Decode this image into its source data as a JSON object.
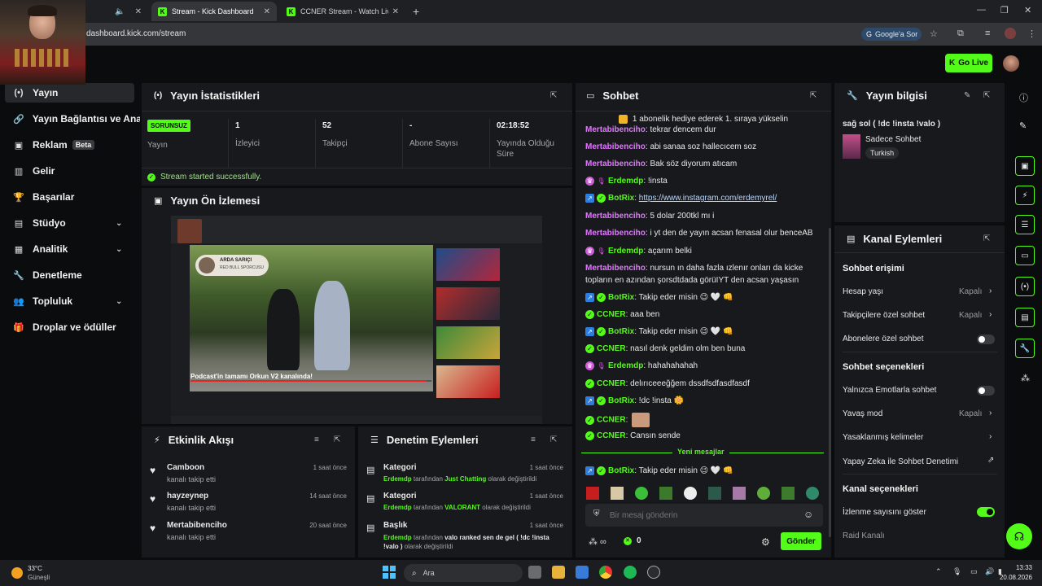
{
  "browser": {
    "tabs": [
      {
        "label": "Stream - Kick Dashboard"
      },
      {
        "label": "CCNER Stream - Watch Live on"
      }
    ],
    "url": "dashboard.kick.com/stream",
    "google_btn": "Google'a Sor"
  },
  "header": {
    "go_live": "Go Live"
  },
  "sidebar": {
    "items": [
      {
        "label": "Yayın"
      },
      {
        "label": "Yayın Bağlantısı ve Anahtar"
      },
      {
        "label": "Reklam",
        "badge": "Beta"
      },
      {
        "label": "Gelir"
      },
      {
        "label": "Başarılar"
      },
      {
        "label": "Stüdyo"
      },
      {
        "label": "Analitik"
      },
      {
        "label": "Denetleme"
      },
      {
        "label": "Topluluk"
      },
      {
        "label": "Droplar ve ödüller"
      }
    ]
  },
  "stats": {
    "title": "Yayın İstatistikleri",
    "status_badge": "SORUNSUZ",
    "status_label": "Yayın",
    "viewers": {
      "value": "1",
      "label": "İzleyici"
    },
    "followers": {
      "value": "52",
      "label": "Takipçi"
    },
    "subs": {
      "value": "-",
      "label": "Abone Sayısı"
    },
    "uptime": {
      "value": "02:18:52",
      "label": "Yayında Olduğu Süre"
    },
    "success_msg": "Stream started successfully."
  },
  "preview": {
    "title": "Yayın Ön İzlemesi",
    "caption": "Podcast'in tamamı Orkun V2 kanalında!",
    "overlay_name": "ARDA SARIÇI",
    "overlay_sub": "RED BULL SPORCUSU"
  },
  "activity": {
    "title": "Etkinlik Akışı",
    "items": [
      {
        "user": "Camboon",
        "action": "kanalı takip etti",
        "time": "1 saat önce"
      },
      {
        "user": "hayzeynep",
        "action": "kanalı takip etti",
        "time": "14 saat önce"
      },
      {
        "user": "Mertabibenciho",
        "action": "kanalı takip etti",
        "time": "20 saat önce"
      }
    ]
  },
  "moderation": {
    "title": "Denetim Eylemleri",
    "items": [
      {
        "type": "Kategori",
        "actor": "Erdemdp",
        "mid": "tarafından",
        "value": "Just Chatting",
        "tail": "olarak değiştirildi",
        "time": "1 saat önce"
      },
      {
        "type": "Kategori",
        "actor": "Erdemdp",
        "mid": "tarafından",
        "value": "VALORANT",
        "tail": "olarak değiştirildi",
        "time": "1 saat önce"
      },
      {
        "type": "Başlık",
        "actor": "Erdemdp",
        "mid": "tarafından",
        "value": "valo ranked sen de gel ( !dc !insta !valo )",
        "tail": "olarak değiştirildi",
        "time": "1 saat önce"
      }
    ]
  },
  "chat": {
    "title": "Sohbet",
    "pinned": "1 abonelik hediye ederek 1. sıraya yükselin",
    "messages": [
      {
        "user": "Mertabibenciho",
        "text": "tekrar dencem dur"
      },
      {
        "user": "Mertabibenciho",
        "text": "abi sanaa soz hallecıcem soz"
      },
      {
        "user": "Mertabibenciho",
        "text": "Bak söz diyorum atıcam"
      },
      {
        "user": "Erdemdp",
        "text": "!insta"
      },
      {
        "user": "BotRix",
        "text": "https://www.instagram.com/erdemyrel/"
      },
      {
        "user": "Mertabibenciho",
        "text": "5 dolar 200tkl mı i"
      },
      {
        "user": "Mertabibenciho",
        "text": "i yt den de yayın acsan fenasal olur benceAB"
      },
      {
        "user": "Erdemdp",
        "text": "açarım belki"
      },
      {
        "user": "Mertabibenciho",
        "text": "nursun ın daha fazla ızlenır onları da kicke"
      },
      {
        "user": "",
        "text": "topların en azından şorsdtdada görüIYT den acsan yaşasın"
      },
      {
        "user": "BotRix",
        "text": "Takip eder misin 😉 🤍 👊"
      },
      {
        "user": "CCNER",
        "text": "aaa ben"
      },
      {
        "user": "BotRix",
        "text": "Takip eder misin 😉 🤍 👊"
      },
      {
        "user": "CCNER",
        "text": "nasıl denk geldim olm ben buna"
      },
      {
        "user": "Erdemdp",
        "text": "hahahahahah"
      },
      {
        "user": "CCNER",
        "text": "delırıceeeğğem dssdfsdfasdfasdf"
      },
      {
        "user": "BotRix",
        "text": "!dc !insta 🌼"
      },
      {
        "user": "CCNER",
        "text": ""
      },
      {
        "user": "CCNER",
        "text": "Cansın sende"
      },
      {
        "user": "BotRix",
        "text": "Takip eder misin 😉 🤍 👊"
      }
    ],
    "new_messages": "Yeni mesajlar",
    "input_placeholder": "Bir mesaj gönderin",
    "points": "0",
    "send": "Gönder"
  },
  "stream_info": {
    "title": "Yayın bilgisi",
    "stream_title": "sağ sol ( !dc !insta !valo )",
    "category": "Sadece Sohbet",
    "language": "Turkish"
  },
  "channel_actions": {
    "title": "Kanal Eylemleri",
    "chat_access": "Sohbet erişimi",
    "account_age": {
      "label": "Hesap yaşı",
      "value": "Kapalı"
    },
    "followers_only": {
      "label": "Takipçilere özel sohbet",
      "value": "Kapalı"
    },
    "subs_only": {
      "label": "Abonelere özel sohbet"
    },
    "chat_options": "Sohbet seçenekleri",
    "emote_only": {
      "label": "Yalnızca Emotlarla sohbet"
    },
    "slow_mode": {
      "label": "Yavaş mod",
      "value": "Kapalı"
    },
    "banned_words": {
      "label": "Yasaklanmış kelimeler"
    },
    "ai_mod": {
      "label": "Yapay Zeka ile Sohbet Denetimi"
    },
    "channel_options": "Kanal seçenekleri",
    "show_viewers": {
      "label": "İzlenme sayısını göster"
    },
    "raid": {
      "label": "Raid Kanalı"
    }
  },
  "taskbar": {
    "weather_temp": "33°C",
    "weather_desc": "Güneşli",
    "search": "Ara",
    "time": "13:33",
    "date": "20.08.2026"
  },
  "colors": {
    "accent": "#53fc18",
    "bg": "#0b0c0e",
    "panel": "#18191c"
  }
}
